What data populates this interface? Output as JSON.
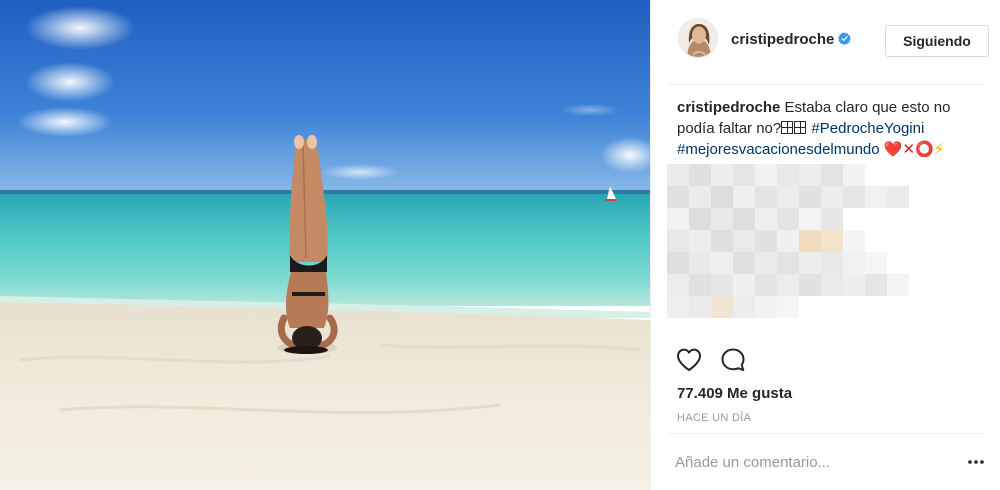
{
  "post": {
    "username": "cristipedroche",
    "follow_label": "Siguiendo",
    "caption": {
      "user": "cristipedroche",
      "text_1": "Estaba claro que esto no podía faltar no?",
      "hashtag_1": "#PedrocheYogini",
      "hashtag_2": "#mejoresvacacionesdelmundo",
      "emoji_heart": "❤️",
      "emoji_x": "✕",
      "emoji_o": "⭕",
      "emoji_bolt": "⚡"
    },
    "likes": "77.409 Me gusta",
    "time_ago": "HACE UN DÍA",
    "comment_placeholder": "Añade un comentario..."
  },
  "icons": {
    "verified": "verified-badge-icon",
    "like": "heart-outline-icon",
    "comment": "comment-bubble-icon",
    "more": "more-options-icon"
  },
  "colors": {
    "verified_blue": "#3897f0",
    "hashtag_blue": "#003569",
    "secondary_text": "#999999",
    "border": "#dbdbdb"
  }
}
